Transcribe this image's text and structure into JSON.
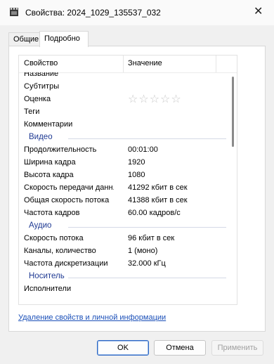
{
  "window": {
    "title": "Свойства: 2024_1029_135537_032",
    "close_glyph": "✕"
  },
  "tabs": [
    {
      "label": "Общие"
    },
    {
      "label": "Подробно"
    }
  ],
  "table": {
    "headers": {
      "property": "Свойство",
      "value": "Значение"
    },
    "rows": [
      {
        "key": "Название",
        "value": ""
      },
      {
        "key": "Субтитры",
        "value": ""
      },
      {
        "key": "Оценка",
        "value": "☆☆☆☆☆",
        "rating": 0
      },
      {
        "key": "Теги",
        "value": ""
      },
      {
        "key": "Комментарии",
        "value": ""
      },
      {
        "group": "Видео"
      },
      {
        "key": "Продолжительность",
        "value": "00:01:00"
      },
      {
        "key": "Ширина кадра",
        "value": "1920"
      },
      {
        "key": "Высота кадра",
        "value": "1080"
      },
      {
        "key": "Скорость передачи данн...",
        "value": "41292 кбит в сек"
      },
      {
        "key": "Общая скорость потока",
        "value": "41388 кбит в сек"
      },
      {
        "key": "Частота кадров",
        "value": "60.00 кадров/с"
      },
      {
        "group": "Аудио"
      },
      {
        "key": "Скорость потока",
        "value": "96 кбит в сек"
      },
      {
        "key": "Каналы, количество",
        "value": "1 (моно)"
      },
      {
        "key": "Частота дискретизации",
        "value": "32.000 кГц"
      },
      {
        "group": "Носитель"
      },
      {
        "key": "Исполнители",
        "value": ""
      }
    ]
  },
  "remove_link": "Удаление свойств и личной информации",
  "buttons": {
    "ok": "OK",
    "cancel": "Отмена",
    "apply": "Применить"
  },
  "colors": {
    "accent": "#1f3a93",
    "link": "#1a4fb8",
    "ok_border": "#2b66c4"
  }
}
